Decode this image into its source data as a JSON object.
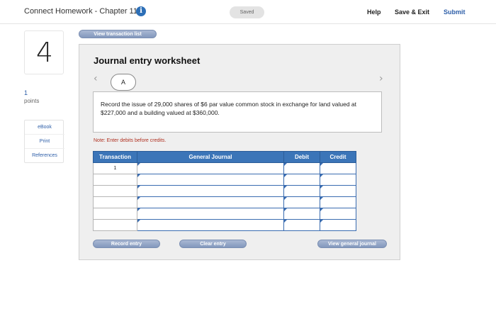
{
  "header": {
    "title": "Connect Homework - Chapter 11",
    "info_icon": "i",
    "saved": "Saved",
    "help": "Help",
    "save_exit": "Save & Exit",
    "submit": "Submit"
  },
  "question": {
    "number": "4",
    "points_value": "1",
    "points_label": "points"
  },
  "side_links": {
    "ebook": "eBook",
    "print": "Print",
    "references": "References"
  },
  "buttons": {
    "view_transaction_list": "View transaction list",
    "record_entry": "Record entry",
    "clear_entry": "Clear entry",
    "view_general_journal": "View general journal"
  },
  "worksheet": {
    "title": "Journal entry worksheet",
    "chevron_left": "‹",
    "chevron_right": "›",
    "tab": "A",
    "instruction": "Record the issue of 29,000 shares of $6 par value common stock in exchange for land valued at $227,000 and a building valued at $360,000.",
    "note": "Note: Enter debits before credits."
  },
  "table": {
    "headers": {
      "transaction": "Transaction",
      "general_journal": "General Journal",
      "debit": "Debit",
      "credit": "Credit"
    },
    "rows": [
      {
        "transaction": "1",
        "account": "",
        "debit": "",
        "credit": ""
      },
      {
        "transaction": "",
        "account": "",
        "debit": "",
        "credit": ""
      },
      {
        "transaction": "",
        "account": "",
        "debit": "",
        "credit": ""
      },
      {
        "transaction": "",
        "account": "",
        "debit": "",
        "credit": ""
      },
      {
        "transaction": "",
        "account": "",
        "debit": "",
        "credit": ""
      },
      {
        "transaction": "",
        "account": "",
        "debit": "",
        "credit": ""
      }
    ]
  },
  "colors": {
    "accent_blue": "#2d5ea8",
    "table_header": "#3b75b8",
    "note_red": "#b03020"
  }
}
